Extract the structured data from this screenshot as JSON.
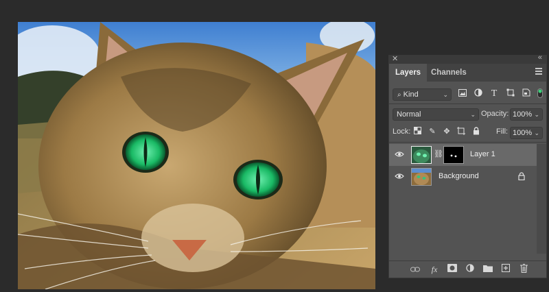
{
  "panel": {
    "tabs": [
      {
        "label": "Layers",
        "active": true
      },
      {
        "label": "Channels",
        "active": false
      }
    ],
    "filter": {
      "kind_label": "Kind",
      "icons": [
        "image-filter-icon",
        "adjustment-filter-icon",
        "type-filter-icon",
        "shape-filter-icon",
        "smart-object-filter-icon",
        "filter-toggle"
      ]
    },
    "blend_mode": "Normal",
    "opacity_label": "Opacity:",
    "opacity_value": "100%",
    "lock_label": "Lock:",
    "fill_label": "Fill:",
    "fill_value": "100%",
    "layers": [
      {
        "name": "Layer 1",
        "selected": true,
        "has_mask": true,
        "locked": false
      },
      {
        "name": "Background",
        "selected": false,
        "has_mask": false,
        "locked": true
      }
    ],
    "footer_icons": [
      "link-layers-icon",
      "fx-icon",
      "add-mask-icon",
      "adjustment-layer-icon",
      "new-group-icon",
      "new-layer-icon",
      "trash-icon"
    ]
  },
  "colors": {
    "panel_bg": "#535353",
    "app_bg": "#2b2b2b",
    "selected_row": "#696969",
    "eye_green": "#22c97a"
  }
}
